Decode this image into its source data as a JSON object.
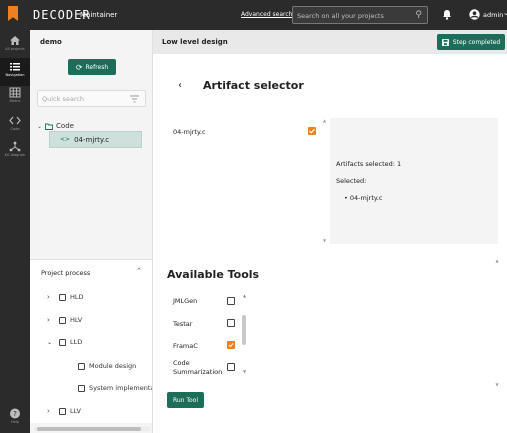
{
  "header": {
    "brand": "DECODER",
    "role": "Maintainer",
    "advanced_search": "Advanced search",
    "search_placeholder": "Search on all your projects",
    "user": "admin"
  },
  "rail": {
    "items": [
      {
        "label": "All projects",
        "icon": "home-icon"
      },
      {
        "label": "Navigation",
        "icon": "list-icon"
      },
      {
        "label": "Matrix",
        "icon": "grid-icon"
      },
      {
        "label": "Code",
        "icon": "code-icon"
      },
      {
        "label": "KG diagram",
        "icon": "graph-icon"
      }
    ],
    "help_label": "Help"
  },
  "project_panel": {
    "project_name": "demo",
    "refresh_label": "Refresh",
    "quick_search_placeholder": "Quick search",
    "tree_root": "Code",
    "tree_file": "04-mjrty.c",
    "process_title": "Project process",
    "process_items": [
      "HLD",
      "HLV",
      "LLD",
      "Module design",
      "System implementat",
      "LLV"
    ]
  },
  "subheader": {
    "title": "Low level design",
    "step_button": "Step completed"
  },
  "artifact_selector": {
    "title": "Artifact selector",
    "items": [
      {
        "name": "04-mjrty.c",
        "checked": true
      }
    ],
    "selected_count": "Artifacts selected: 1",
    "selected_label": "Selected:",
    "selected_items": [
      "04-mjrty.c"
    ]
  },
  "tools": {
    "title": "Available Tools",
    "items": [
      {
        "name": "JMLGen",
        "checked": false
      },
      {
        "name": "Testar",
        "checked": false
      },
      {
        "name": "FramaC",
        "checked": true
      },
      {
        "name": "Code Summarization",
        "checked": false
      }
    ],
    "run_button": "Run Tool"
  },
  "colors": {
    "accent_green": "#1c6e5a",
    "accent_orange": "#f07f1e",
    "topbar": "#2b2b2b"
  }
}
